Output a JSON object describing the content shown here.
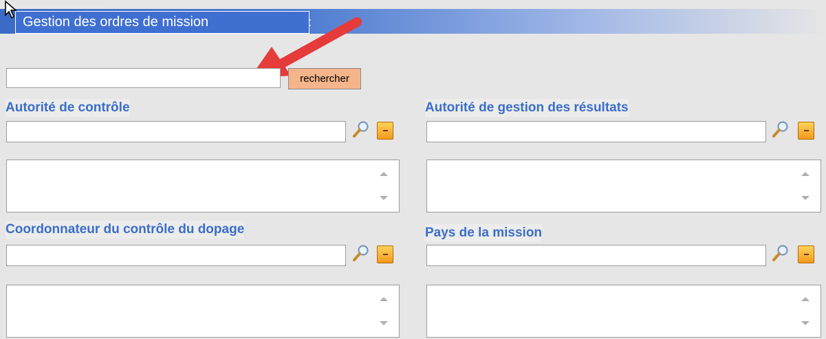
{
  "header": {
    "title": "Gestion des ordres de mission"
  },
  "search": {
    "value": "",
    "button_label": "rechercher"
  },
  "sections": [
    {
      "label": "Autorité de contrôle",
      "field_value": ""
    },
    {
      "label": "Autorité de gestion des résultats",
      "field_value": ""
    },
    {
      "label": "Coordonnateur du contrôle du dopage",
      "field_value": ""
    },
    {
      "label": "Pays de la mission",
      "field_value": ""
    }
  ],
  "icons": {
    "lookup": "magnifier-icon",
    "clear": "clear-icon"
  },
  "colors": {
    "title_bar": "#3f6fd0",
    "label": "#3b6ec8",
    "button": "#f6b48a",
    "annotation_arrow": "#e53b3b"
  }
}
